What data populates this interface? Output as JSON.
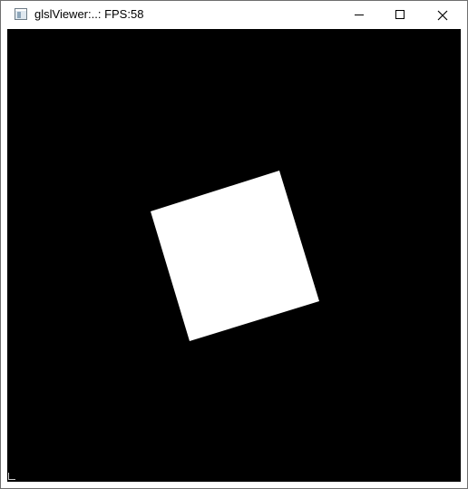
{
  "window": {
    "title": "glslViewer:..: FPS:58",
    "controls": {
      "minimize_icon": "minimize-icon",
      "maximize_icon": "maximize-icon",
      "close_icon": "close-icon"
    }
  },
  "scene": {
    "background_color": "#000000",
    "shape_color": "#ffffff",
    "shape": "rotated white square"
  }
}
